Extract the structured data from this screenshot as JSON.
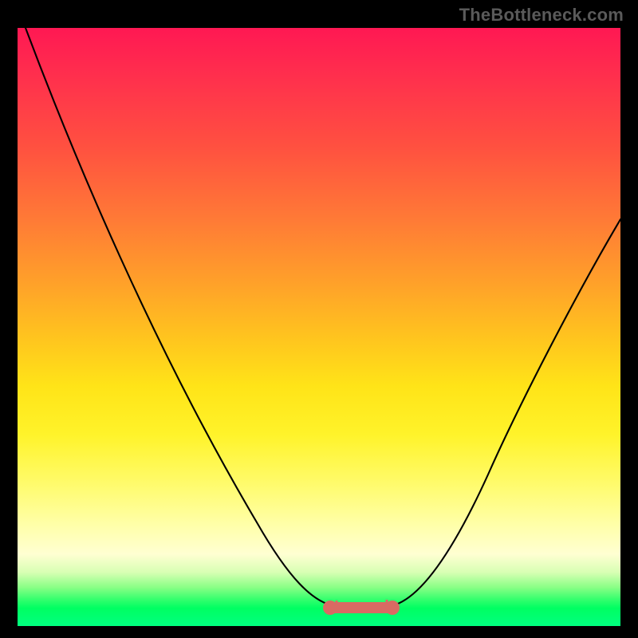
{
  "watermark": "TheBottleneck.com",
  "chart_data": {
    "type": "line",
    "title": "",
    "xlabel": "",
    "ylabel": "",
    "xlim": [
      0,
      100
    ],
    "ylim": [
      0,
      100
    ],
    "x": [
      0,
      5,
      10,
      15,
      20,
      25,
      30,
      35,
      40,
      45,
      48,
      50,
      52,
      55,
      58,
      62,
      66,
      70,
      75,
      80,
      85,
      90,
      95,
      100
    ],
    "values": [
      100,
      92,
      83,
      74,
      65,
      56,
      47,
      38,
      29,
      17,
      8,
      3,
      1,
      0,
      0,
      1,
      4,
      10,
      19,
      28,
      37,
      45,
      52,
      58
    ],
    "flat_segment": {
      "x_start": 50,
      "x_end": 62,
      "y": 0.5
    }
  }
}
